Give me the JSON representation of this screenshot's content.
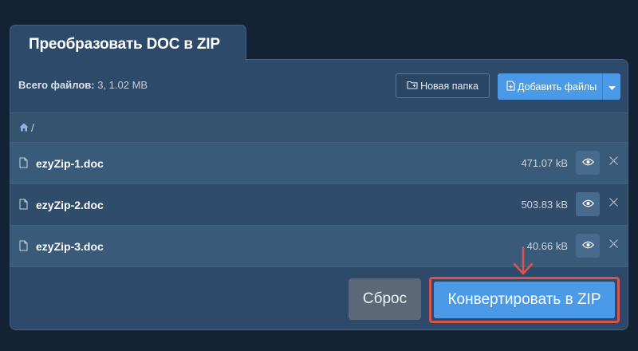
{
  "tab": {
    "title": "Преобразовать DOC в ZIP"
  },
  "summary": {
    "label": "Всего файлов:",
    "value": "3, 1.02 MB"
  },
  "toolbar": {
    "new_folder_label": "Новая папка",
    "add_files_label": "Добавить файлы"
  },
  "breadcrumb": {
    "path": "/"
  },
  "files": [
    {
      "name": "ezyZip-1.doc",
      "size": "471.07 kB"
    },
    {
      "name": "ezyZip-2.doc",
      "size": "503.83 kB"
    },
    {
      "name": "ezyZip-3.doc",
      "size": "40.66 kB"
    }
  ],
  "actions": {
    "reset_label": "Сброс",
    "convert_label": "Конвертировать в ZIP"
  },
  "icons": {
    "folder": "folder-plus-icon",
    "add": "file-plus-icon",
    "caret": "chevron-down-icon",
    "home": "home-icon",
    "file": "file-icon",
    "eye": "eye-icon",
    "close": "close-icon",
    "arrow": "arrow-down-icon"
  },
  "colors": {
    "background": "#142235",
    "panel": "#2d4a6a",
    "accent": "#4a9ae8",
    "highlight": "#d9534f",
    "reset": "#5a6878"
  }
}
